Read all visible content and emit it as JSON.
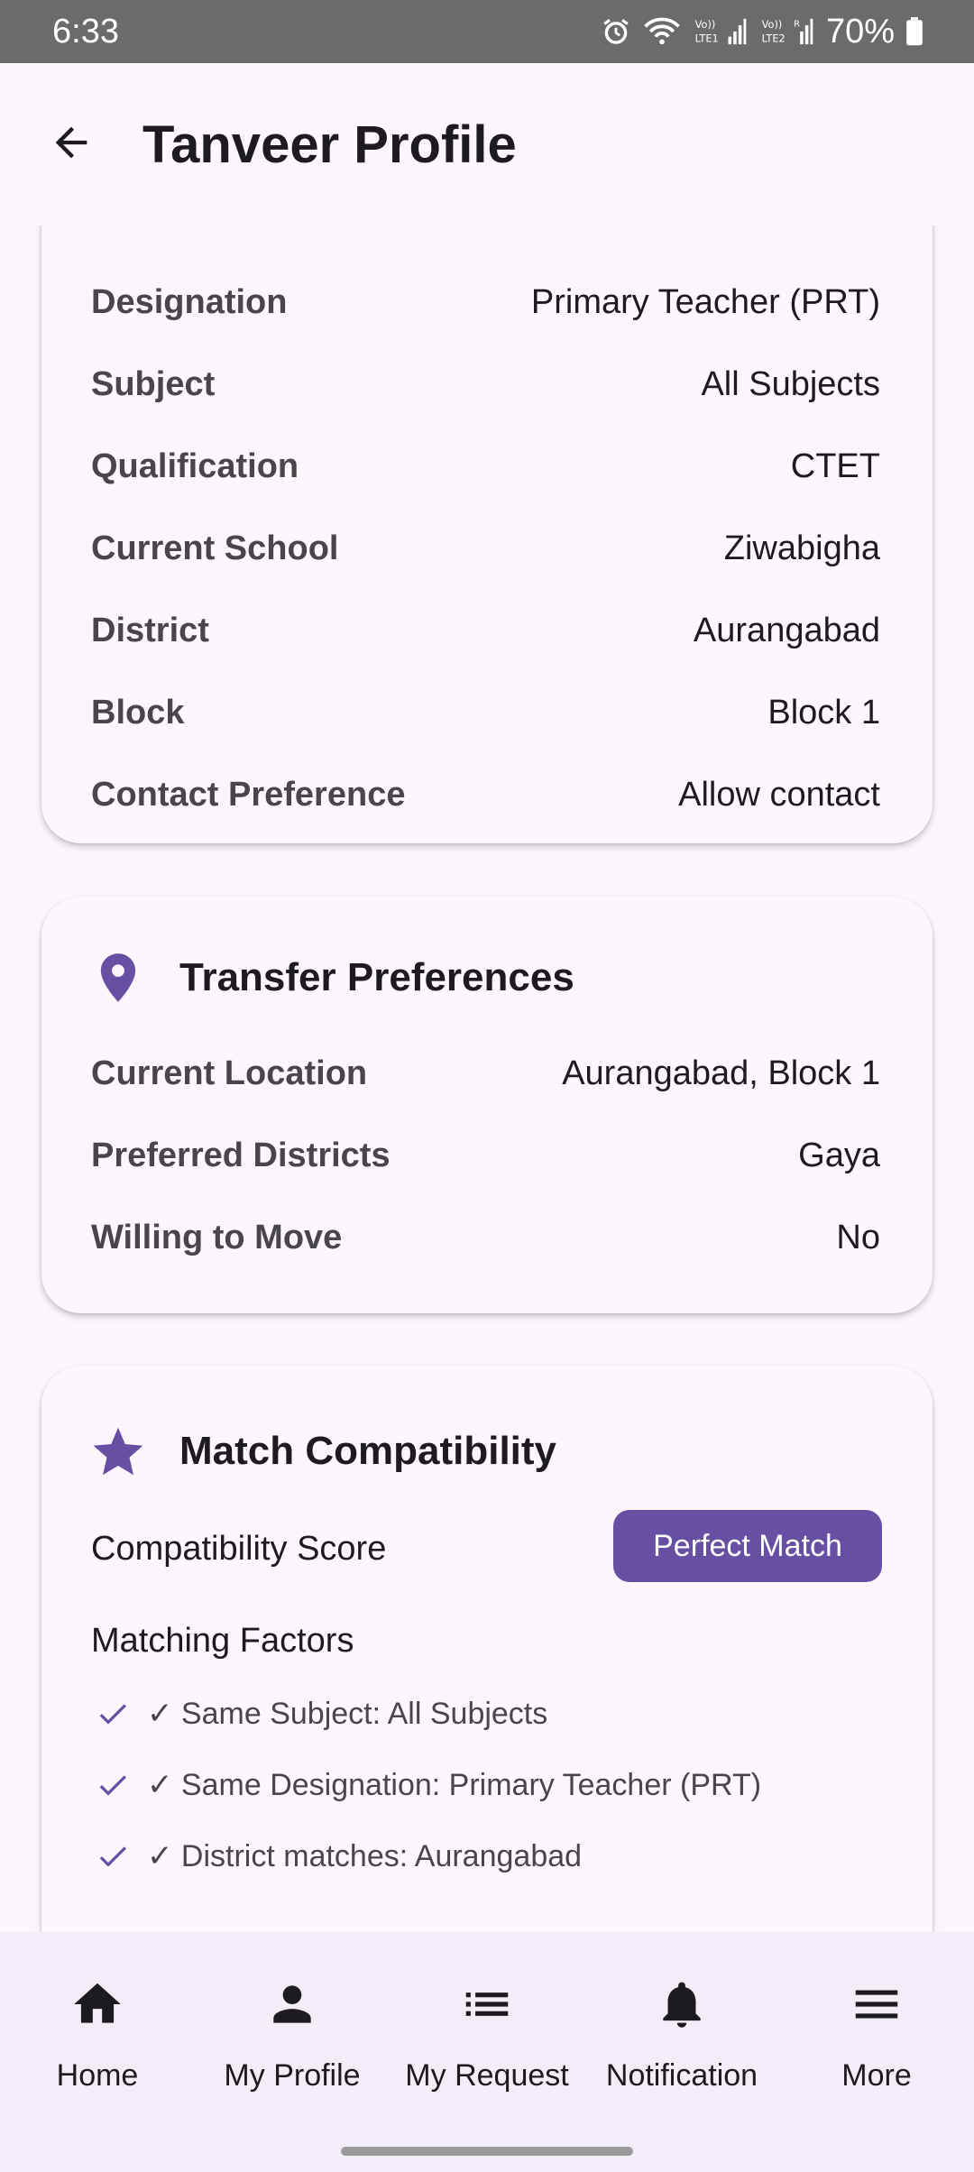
{
  "status_bar": {
    "time": "6:33",
    "battery": "70%",
    "icons": [
      "alarm-icon",
      "wifi-icon",
      "lte1-signal-icon",
      "lte2-signal-icon",
      "battery-icon"
    ]
  },
  "app_bar": {
    "title": "Tanveer Profile",
    "back_icon": "arrow-back-icon"
  },
  "profile_card": {
    "rows": [
      {
        "label": "Designation",
        "value": "Primary Teacher (PRT)"
      },
      {
        "label": "Subject",
        "value": "All Subjects"
      },
      {
        "label": "Qualification",
        "value": "CTET"
      },
      {
        "label": "Current School",
        "value": "Ziwabigha"
      },
      {
        "label": "District",
        "value": "Aurangabad"
      },
      {
        "label": "Block",
        "value": "Block 1"
      },
      {
        "label": "Contact Preference",
        "value": "Allow contact"
      }
    ]
  },
  "transfer_card": {
    "title": "Transfer Preferences",
    "icon": "location-pin-icon",
    "rows": [
      {
        "label": "Current Location",
        "value": "Aurangabad, Block 1"
      },
      {
        "label": "Preferred Districts",
        "value": "Gaya"
      },
      {
        "label": "Willing to Move",
        "value": "No"
      }
    ]
  },
  "match_card": {
    "title": "Match Compatibility",
    "icon": "star-icon",
    "score_label": "Compatibility Score",
    "badge": "Perfect Match",
    "factors_title": "Matching Factors",
    "factors": [
      "✓ Same Subject: All Subjects",
      "✓ Same Designation: Primary Teacher (PRT)",
      "✓ District matches: Aurangabad"
    ]
  },
  "bottom_nav": {
    "items": [
      {
        "label": "Home",
        "icon": "home-icon"
      },
      {
        "label": "My Profile",
        "icon": "person-icon"
      },
      {
        "label": "My Request",
        "icon": "list-icon"
      },
      {
        "label": "Notification",
        "icon": "bell-icon"
      },
      {
        "label": "More",
        "icon": "menu-icon"
      }
    ]
  },
  "colors": {
    "accent": "#6750a4",
    "background": "#fdf7fd",
    "nav_background": "#f3edf7",
    "status_bar": "#6b6b6b"
  }
}
